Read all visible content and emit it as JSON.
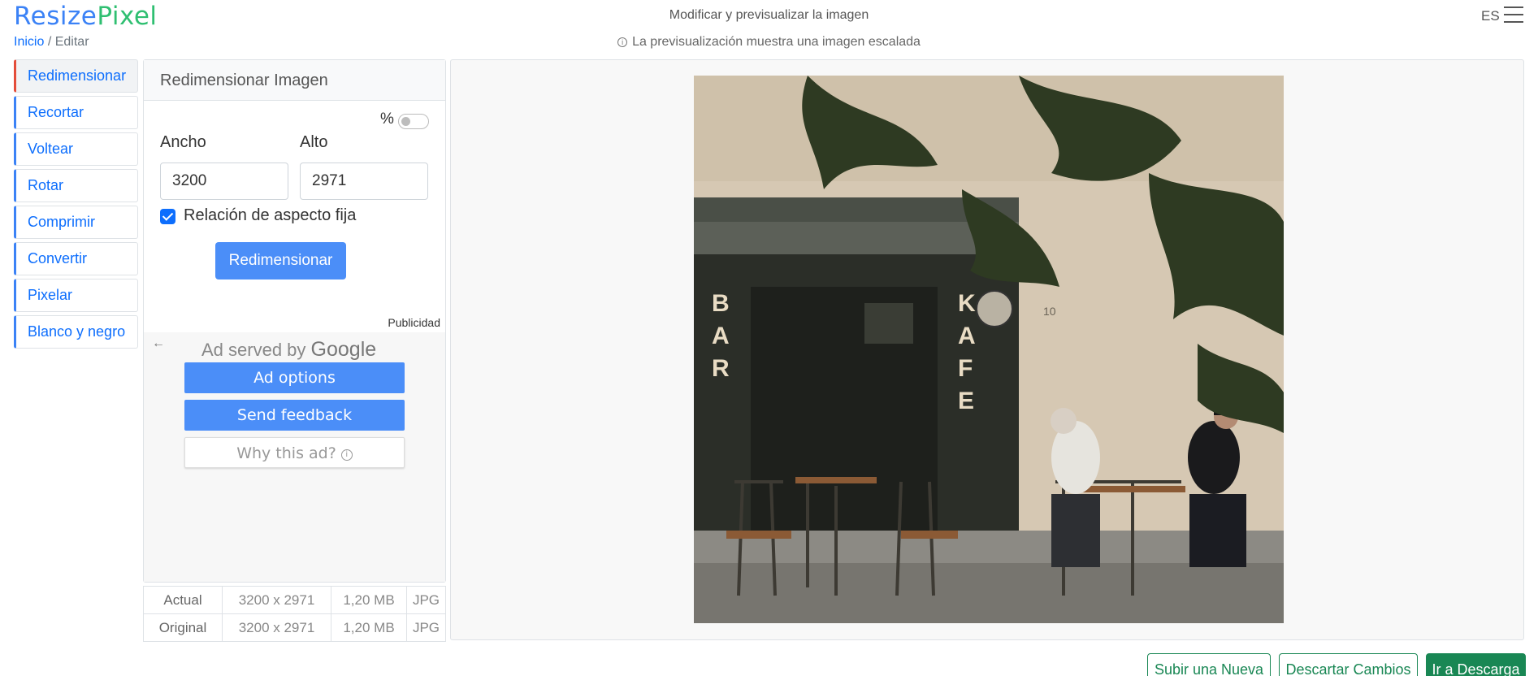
{
  "brand": {
    "part1": "Resize",
    "part2": "Pixel"
  },
  "breadcrumb": {
    "home": "Inicio",
    "separator": "/",
    "current": "Editar"
  },
  "header": {
    "title": "Modificar y previsualizar la imagen",
    "note": "La previsualización muestra una imagen escalada",
    "lang": "ES"
  },
  "sidebar": {
    "items": [
      {
        "label": "Redimensionar"
      },
      {
        "label": "Recortar"
      },
      {
        "label": "Voltear"
      },
      {
        "label": "Rotar"
      },
      {
        "label": "Comprimir"
      },
      {
        "label": "Convertir"
      },
      {
        "label": "Pixelar"
      },
      {
        "label": "Blanco y negro"
      }
    ]
  },
  "panel": {
    "title": "Redimensionar Imagen",
    "percent_label": "%",
    "percent_enabled": false,
    "width_label": "Ancho",
    "height_label": "Alto",
    "width_value": "3200",
    "height_value": "2971",
    "aspect_label": "Relación de aspecto fija",
    "aspect_checked": true,
    "submit_label": "Redimensionar"
  },
  "ad": {
    "label": "Publicidad",
    "served_by": "Ad served by",
    "brand": "Google",
    "options": "Ad options",
    "feedback": "Send feedback",
    "why": "Why this ad?"
  },
  "info_table": {
    "rows": [
      {
        "label": "Actual",
        "dims": "3200 x 2971",
        "size": "1,20 MB",
        "format": "JPG"
      },
      {
        "label": "Original",
        "dims": "3200 x 2971",
        "size": "1,20 MB",
        "format": "JPG"
      }
    ]
  },
  "preview": {
    "sign_left": "BAR",
    "sign_right": "KAFE",
    "wall_number": "10"
  },
  "footer": {
    "upload_new": "Subir una Nueva",
    "discard": "Descartar Cambios",
    "download": "Ir a Descarga"
  }
}
